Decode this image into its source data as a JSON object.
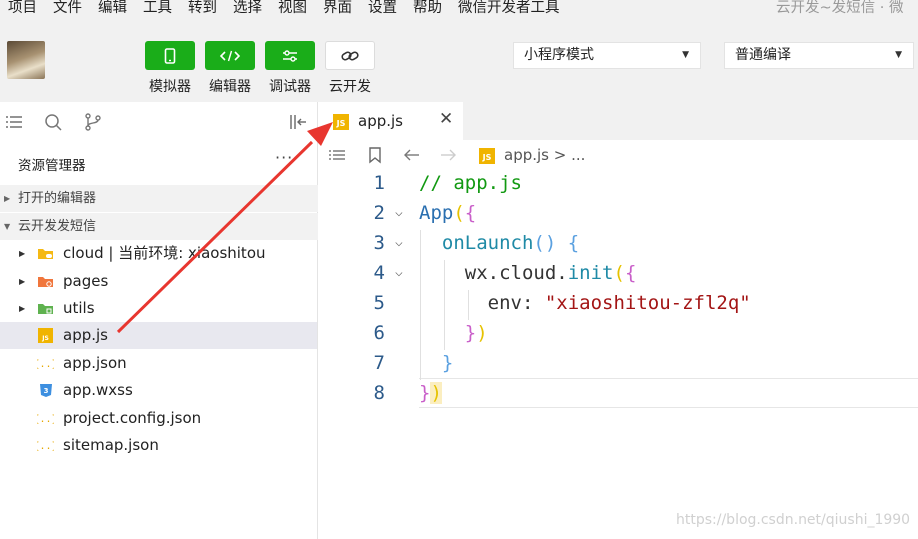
{
  "menu": {
    "items": [
      "项目",
      "文件",
      "编辑",
      "工具",
      "转到",
      "选择",
      "视图",
      "界面",
      "设置",
      "帮助",
      "微信开发者工具"
    ],
    "window_title": "云开发~发短信 · 微"
  },
  "toolbar": {
    "simulator_label": "模拟器",
    "editor_label": "编辑器",
    "debugger_label": "调试器",
    "cloud_label": "云开发",
    "mode_select": "小程序模式",
    "compile_select": "普通编译"
  },
  "sidebar": {
    "explorer_title": "资源管理器",
    "more": "···",
    "open_editors_label": "打开的编辑器",
    "project_label": "云开发发短信",
    "tree": [
      {
        "name": "cloud | 当前环境: xiaoshitou",
        "type": "folder-cloud",
        "expandable": true
      },
      {
        "name": "pages",
        "type": "folder-pages",
        "expandable": true
      },
      {
        "name": "utils",
        "type": "folder-utils",
        "expandable": true
      },
      {
        "name": "app.js",
        "type": "js",
        "expandable": false,
        "active": true
      },
      {
        "name": "app.json",
        "type": "json",
        "expandable": false
      },
      {
        "name": "app.wxss",
        "type": "css",
        "expandable": false
      },
      {
        "name": "project.config.json",
        "type": "json",
        "expandable": false
      },
      {
        "name": "sitemap.json",
        "type": "json",
        "expandable": false
      }
    ]
  },
  "editor": {
    "tab": {
      "label": "app.js",
      "close": "✕",
      "icon": "JS"
    },
    "breadcrumb": "app.js > ...",
    "line_numbers": [
      "1",
      "2",
      "3",
      "4",
      "5",
      "6",
      "7",
      "8"
    ],
    "code": {
      "l1_comment": "// app.js",
      "l2_ident": "App",
      "l2_paren": "(",
      "l2_brace": "{",
      "l3_fn": "onLaunch",
      "l3_parens": "()",
      "l3_brace": " {",
      "l4_obj": "wx.cloud.",
      "l4_fn": "init",
      "l4_paren": "(",
      "l4_brace": "{",
      "l5_key": "env: ",
      "l5_str": "\"xiaoshitou-zfl2q\"",
      "l6_brace": "}",
      "l6_paren": ")",
      "l7_brace": "}",
      "l8_brace": "}",
      "l8_paren": ")"
    }
  },
  "watermark": "https://blog.csdn.net/qiushi_1990",
  "colors": {
    "accent_green": "#1aad19",
    "annotation_red": "#e8362f",
    "js_icon": "#f0b400"
  }
}
